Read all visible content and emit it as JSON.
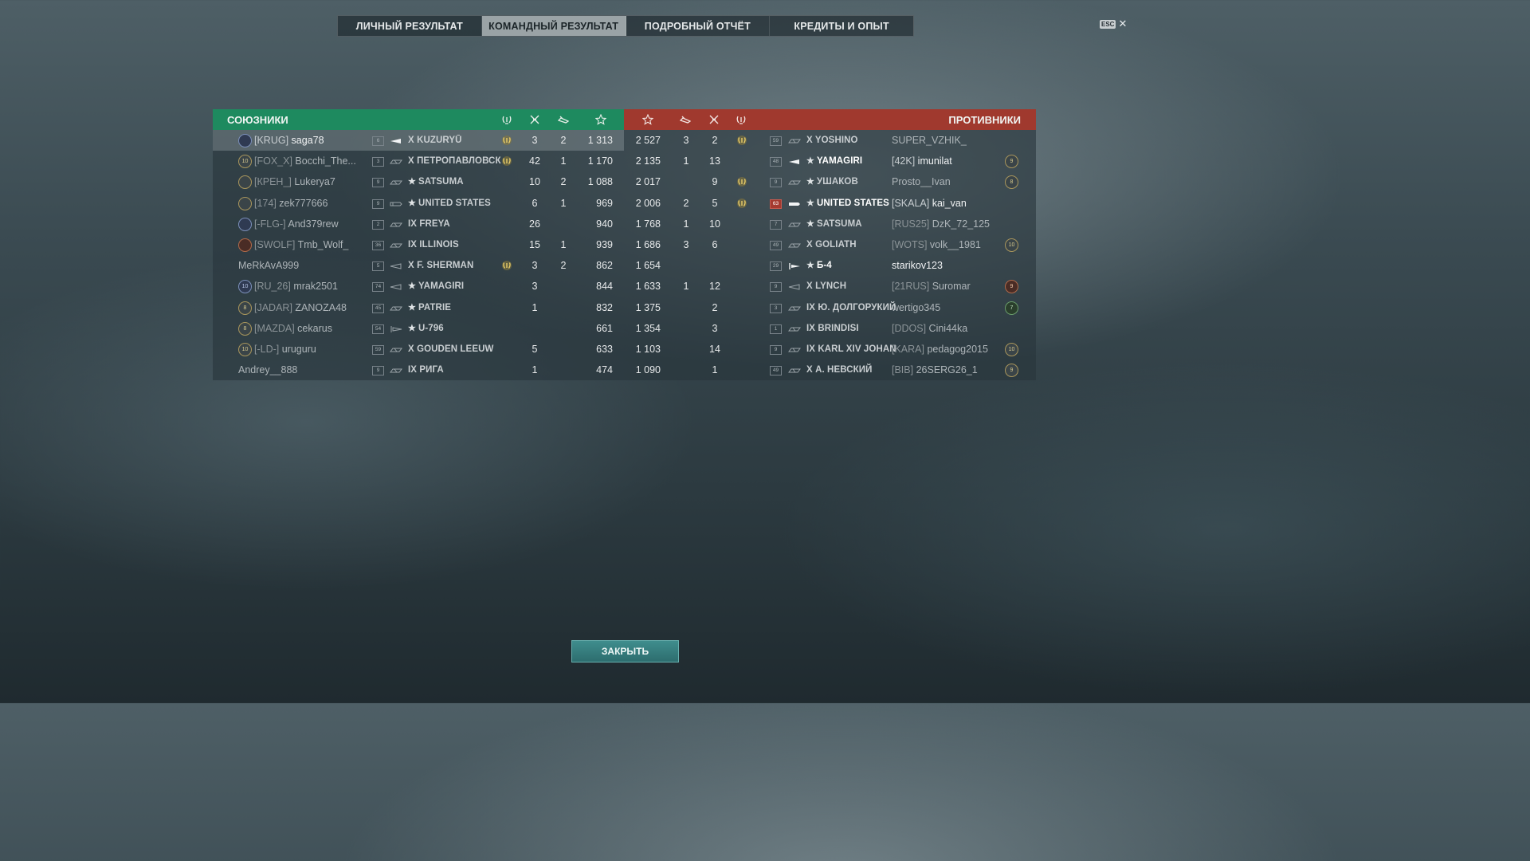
{
  "tabs": [
    "ЛИЧНЫЙ РЕЗУЛЬТАТ",
    "КОМАНДНЫЙ РЕЗУЛЬТАТ",
    "ПОДРОБНЫЙ ОТЧЁТ",
    "КРЕДИТЫ И ОПЫТ"
  ],
  "active_tab": 1,
  "esc": {
    "key": "ESC",
    "close": "✕"
  },
  "allies_title": "СОЮЗНИКИ",
  "enemies_title": "ПРОТИВНИКИ",
  "header_icons": {
    "allies": [
      "laurel-icon",
      "planes-destroyed-icon",
      "ships-destroyed-icon",
      "base-xp-star-icon"
    ],
    "enemies": [
      "base-xp-star-icon",
      "ships-destroyed-icon",
      "planes-destroyed-icon",
      "laurel-icon"
    ]
  },
  "allies": [
    {
      "badge": "",
      "badge_color": "blue",
      "tag": "[KRUG]",
      "name": "saga78",
      "level": "6",
      "ship_type": "destroyer-filled",
      "ship": "X KUZURYŪ",
      "premium": false,
      "laurel": true,
      "planes": "3",
      "ships": "2",
      "xp": "1 313",
      "me": true
    },
    {
      "badge": "10",
      "badge_color": "gold",
      "tag": "[FOX_X]",
      "name": "Bocchi_The...",
      "level": "3",
      "ship_type": "cruiser",
      "ship": "X ПЕТРОПАВЛОВСК",
      "premium": false,
      "laurel": true,
      "planes": "42",
      "ships": "1",
      "xp": "1 170",
      "me": false
    },
    {
      "badge": "",
      "badge_color": "",
      "tag": "[КРЕН_]",
      "name": "Lukerya7",
      "level": "9",
      "ship_type": "cruiser",
      "ship": "SATSUMA",
      "premium": true,
      "laurel": false,
      "planes": "10",
      "ships": "2",
      "xp": "1 088",
      "me": false
    },
    {
      "badge": "",
      "badge_color": "",
      "tag": "[174]",
      "name": "zek777666",
      "level": "9",
      "ship_type": "battleship",
      "ship": "UNITED STATES",
      "premium": true,
      "laurel": false,
      "planes": "6",
      "ships": "1",
      "xp": "969",
      "me": false
    },
    {
      "badge": "",
      "badge_color": "blue",
      "tag": "[-FLG-]",
      "name": "And379rew",
      "level": "2",
      "ship_type": "cruiser",
      "ship": "IX FREYA",
      "premium": false,
      "laurel": false,
      "planes": "26",
      "ships": "",
      "xp": "940",
      "me": false
    },
    {
      "badge": "",
      "badge_color": "red",
      "tag": "[SWOLF]",
      "name": "Tmb_Wolf_",
      "level": "36",
      "ship_type": "cruiser",
      "ship": "IX ILLINOIS",
      "premium": false,
      "laurel": false,
      "planes": "15",
      "ships": "1",
      "xp": "939",
      "me": false
    },
    {
      "badge": null,
      "badge_color": "",
      "tag": "",
      "name": "MeRkAvA999",
      "level": "5",
      "ship_type": "destroyer",
      "ship": "X F. SHERMAN",
      "premium": false,
      "laurel": true,
      "planes": "3",
      "ships": "2",
      "xp": "862",
      "me": false
    },
    {
      "badge": "10",
      "badge_color": "blue",
      "tag": "[RU_26]",
      "name": "mrak2501",
      "level": "74",
      "ship_type": "destroyer",
      "ship": "YAMAGIRI",
      "premium": true,
      "laurel": false,
      "planes": "3",
      "ships": "",
      "xp": "844",
      "me": false
    },
    {
      "badge": "8",
      "badge_color": "gold",
      "tag": "[JADAR]",
      "name": "ZANOZA48",
      "level": "45",
      "ship_type": "cruiser",
      "ship": "PATRIE",
      "premium": true,
      "laurel": false,
      "planes": "1",
      "ships": "",
      "xp": "832",
      "me": false
    },
    {
      "badge": "8",
      "badge_color": "gold",
      "tag": "[MAZDA]",
      "name": "cekarus",
      "level": "54",
      "ship_type": "submarine",
      "ship": "U-796",
      "premium": true,
      "laurel": false,
      "planes": "",
      "ships": "",
      "xp": "661",
      "me": false
    },
    {
      "badge": "10",
      "badge_color": "gold",
      "tag": "[-LD-]",
      "name": "uruguru",
      "level": "59",
      "ship_type": "cruiser",
      "ship": "X GOUDEN LEEUW",
      "premium": false,
      "laurel": false,
      "planes": "5",
      "ships": "",
      "xp": "633",
      "me": false
    },
    {
      "badge": null,
      "badge_color": "",
      "tag": "",
      "name": "Andrey__888",
      "level": "9",
      "ship_type": "cruiser",
      "ship": "IX РИГА",
      "premium": false,
      "laurel": false,
      "planes": "1",
      "ships": "",
      "xp": "474",
      "me": false
    }
  ],
  "enemies": [
    {
      "xp": "2 527",
      "ships": "3",
      "planes": "2",
      "laurel": true,
      "level": "59",
      "level_red": false,
      "ship_type": "cruiser",
      "ship": "X YOSHINO",
      "premium": false,
      "bright": false,
      "tag": "",
      "name": "SUPER_VZHIK_",
      "badge": "",
      "badge_color": ""
    },
    {
      "xp": "2 135",
      "ships": "1",
      "planes": "13",
      "laurel": false,
      "level": "48",
      "level_red": false,
      "ship_type": "destroyer-filled",
      "ship": "YAMAGIRI",
      "premium": true,
      "bright": true,
      "tag": "[42K]",
      "name": "imunilat",
      "badge": "9",
      "badge_color": "gold"
    },
    {
      "xp": "2 017",
      "ships": "",
      "planes": "9",
      "laurel": true,
      "level": "9",
      "level_red": false,
      "ship_type": "cruiser",
      "ship": "УШАКОВ",
      "premium": true,
      "bright": false,
      "tag": "",
      "name": "Prosto__Ivan",
      "badge": "8",
      "badge_color": "gold"
    },
    {
      "xp": "2 006",
      "ships": "2",
      "planes": "5",
      "laurel": true,
      "level": "63",
      "level_red": true,
      "ship_type": "battleship-filled",
      "ship": "UNITED STATES",
      "premium": true,
      "bright": true,
      "tag": "[SKALA]",
      "name": "kai_van",
      "badge": "",
      "badge_color": ""
    },
    {
      "xp": "1 768",
      "ships": "1",
      "planes": "10",
      "laurel": false,
      "level": "7",
      "level_red": false,
      "ship_type": "cruiser",
      "ship": "SATSUMA",
      "premium": true,
      "bright": false,
      "tag": "[RUS25]",
      "name": "DzK_72_125",
      "badge": "",
      "badge_color": ""
    },
    {
      "xp": "1 686",
      "ships": "3",
      "planes": "6",
      "laurel": false,
      "level": "49",
      "level_red": false,
      "ship_type": "cruiser",
      "ship": "X GOLIATH",
      "premium": false,
      "bright": false,
      "tag": "[WOTS]",
      "name": "volk__1981",
      "badge": "10",
      "badge_color": "gold"
    },
    {
      "xp": "1 654",
      "ships": "",
      "planes": "",
      "laurel": false,
      "level": "29",
      "level_red": false,
      "ship_type": "submarine-filled",
      "ship": "Б-4",
      "premium": true,
      "bright": true,
      "tag": "",
      "name": "starikov123",
      "badge": "",
      "badge_color": ""
    },
    {
      "xp": "1 633",
      "ships": "1",
      "planes": "12",
      "laurel": false,
      "level": "9",
      "level_red": false,
      "ship_type": "destroyer",
      "ship": "X LYNCH",
      "premium": false,
      "bright": false,
      "tag": "[21RUS]",
      "name": "Suromar",
      "badge": "9",
      "badge_color": "red"
    },
    {
      "xp": "1 375",
      "ships": "",
      "planes": "2",
      "laurel": false,
      "level": "3",
      "level_red": false,
      "ship_type": "cruiser",
      "ship": "IX Ю. ДОЛГОРУКИЙ",
      "premium": false,
      "bright": false,
      "tag": "",
      "name": "wertigo345",
      "badge": "7",
      "badge_color": "green"
    },
    {
      "xp": "1 354",
      "ships": "",
      "planes": "3",
      "laurel": false,
      "level": "1",
      "level_red": false,
      "ship_type": "cruiser",
      "ship": "IX BRINDISI",
      "premium": false,
      "bright": false,
      "tag": "[DDOS]",
      "name": "Cini44ka",
      "badge": "",
      "badge_color": ""
    },
    {
      "xp": "1 103",
      "ships": "",
      "planes": "14",
      "laurel": false,
      "level": "9",
      "level_red": false,
      "ship_type": "cruiser",
      "ship": "IX KARL XIV JOHAN",
      "premium": false,
      "bright": false,
      "tag": "[KARA]",
      "name": "pedagog2015",
      "badge": "10",
      "badge_color": "gold"
    },
    {
      "xp": "1 090",
      "ships": "",
      "planes": "1",
      "laurel": false,
      "level": "49",
      "level_red": false,
      "ship_type": "cruiser",
      "ship": "X А. НЕВСКИЙ",
      "premium": false,
      "bright": false,
      "tag": "[BIB]",
      "name": "26SERG26_1",
      "badge": "9",
      "badge_color": "gold"
    }
  ],
  "close_button": "ЗАКРЫТЬ"
}
